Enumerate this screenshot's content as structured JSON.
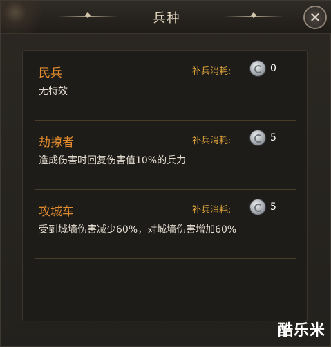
{
  "dialog": {
    "title": "兵种",
    "close_glyph": "✕"
  },
  "units": [
    {
      "name": "民兵",
      "description": "无特效",
      "cost_label": "补兵消耗:",
      "cost_value": "0",
      "cost_icon": "silver-coin-icon"
    },
    {
      "name": "劫掠者",
      "description": "造成伤害时回复伤害值10%的兵力",
      "cost_label": "补兵消耗:",
      "cost_value": "5",
      "cost_icon": "silver-coin-icon"
    },
    {
      "name": "攻城车",
      "description": "受到城墙伤害减少60%，对城墙伤害增加60%",
      "cost_label": "补兵消耗:",
      "cost_value": "5",
      "cost_icon": "silver-coin-icon"
    }
  ],
  "watermark": "酷乐米",
  "colors": {
    "name": "#e38b2d",
    "cost_label": "#d9a23a",
    "text": "#e4ddd0",
    "background": "#1e1c19"
  }
}
